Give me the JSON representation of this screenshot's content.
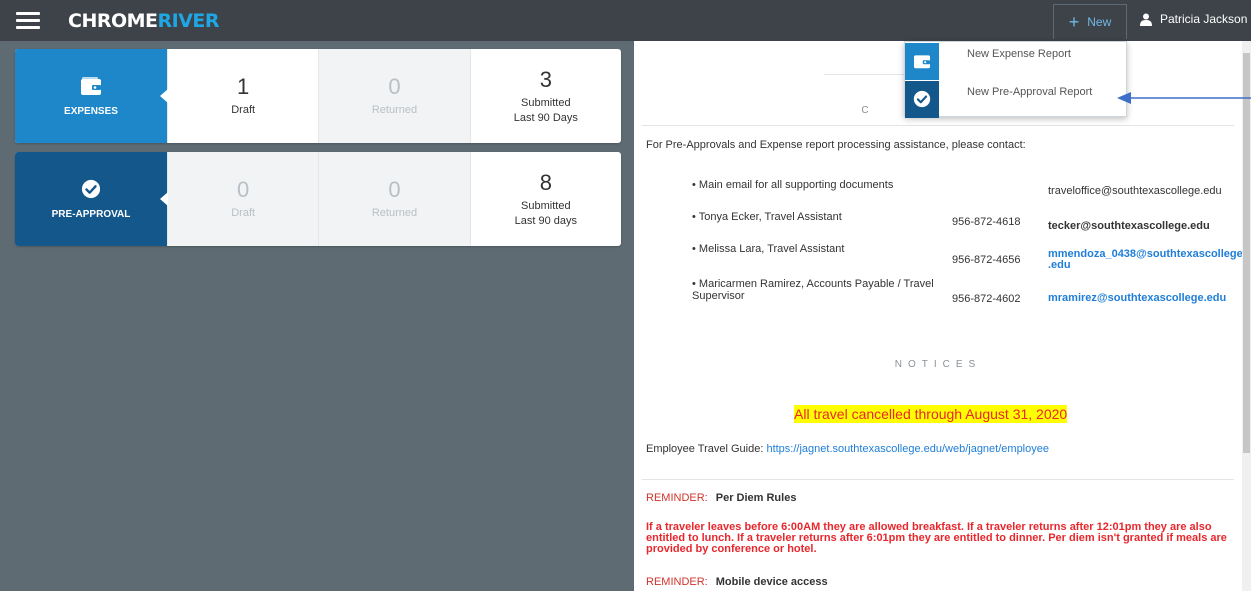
{
  "app": {
    "logo_part1": "CHROME",
    "logo_part2": "RIVER"
  },
  "header": {
    "new_label": "New",
    "user_name": "Patricia Jackson"
  },
  "expenses": {
    "name": "EXPENSES",
    "color": "#1d87c9",
    "draft": {
      "count": "1",
      "label": "Draft"
    },
    "returned": {
      "count": "0",
      "label": "Returned"
    },
    "submitted": {
      "count": "3",
      "label": "Submitted",
      "sub": "Last 90 Days"
    }
  },
  "preapproval": {
    "name": "PRE-APPROVAL",
    "color": "#14578a",
    "draft": {
      "count": "0",
      "label": "Draft"
    },
    "returned": {
      "count": "0",
      "label": "Returned"
    },
    "submitted": {
      "count": "8",
      "label": "Submitted",
      "sub": "Last 90 days"
    }
  },
  "dropdown": {
    "item1": "New Expense Report",
    "item2": "New Pre-Approval Report"
  },
  "contact": {
    "title": "C",
    "intro": "For Pre-Approvals and Expense report processing assistance, please contact:",
    "rows": [
      {
        "name": "Main email for all supporting documents",
        "phone": "",
        "email": "traveloffice@southtexascollege.edu"
      },
      {
        "name": "Tonya Ecker, Travel Assistant",
        "phone": "956-872-4618",
        "email": "tecker@southtexascollege.edu"
      },
      {
        "name": "Melissa Lara, Travel Assistant",
        "phone": "956-872-4656",
        "email": "mmendoza_0438@southtexascollege .edu"
      },
      {
        "name": "Maricarmen Ramirez, Accounts Payable / Travel Supervisor",
        "phone": "956-872-4602",
        "email": "mramirez@southtexascollege.edu"
      }
    ]
  },
  "notices": {
    "title": "NOTICES",
    "banner": "All travel cancelled through August 31, 2020",
    "guide_label": "Employee Travel Guide: ",
    "guide_link": "https://jagnet.southtexascollege.edu/web/jagnet/employee",
    "reminder1_label": "REMINDER:",
    "reminder1_title": "Per Diem Rules",
    "reminder1_text": "If a traveler leaves before 6:00AM they are allowed breakfast. If a traveler returns after 12:01pm they are also entitled to lunch. If a traveler returns after 6:01pm they are entitled to dinner. Per diem isn't granted if meals are provided by conference or hotel.",
    "reminder2_label": "REMINDER:",
    "reminder2_title": "Mobile device access"
  }
}
